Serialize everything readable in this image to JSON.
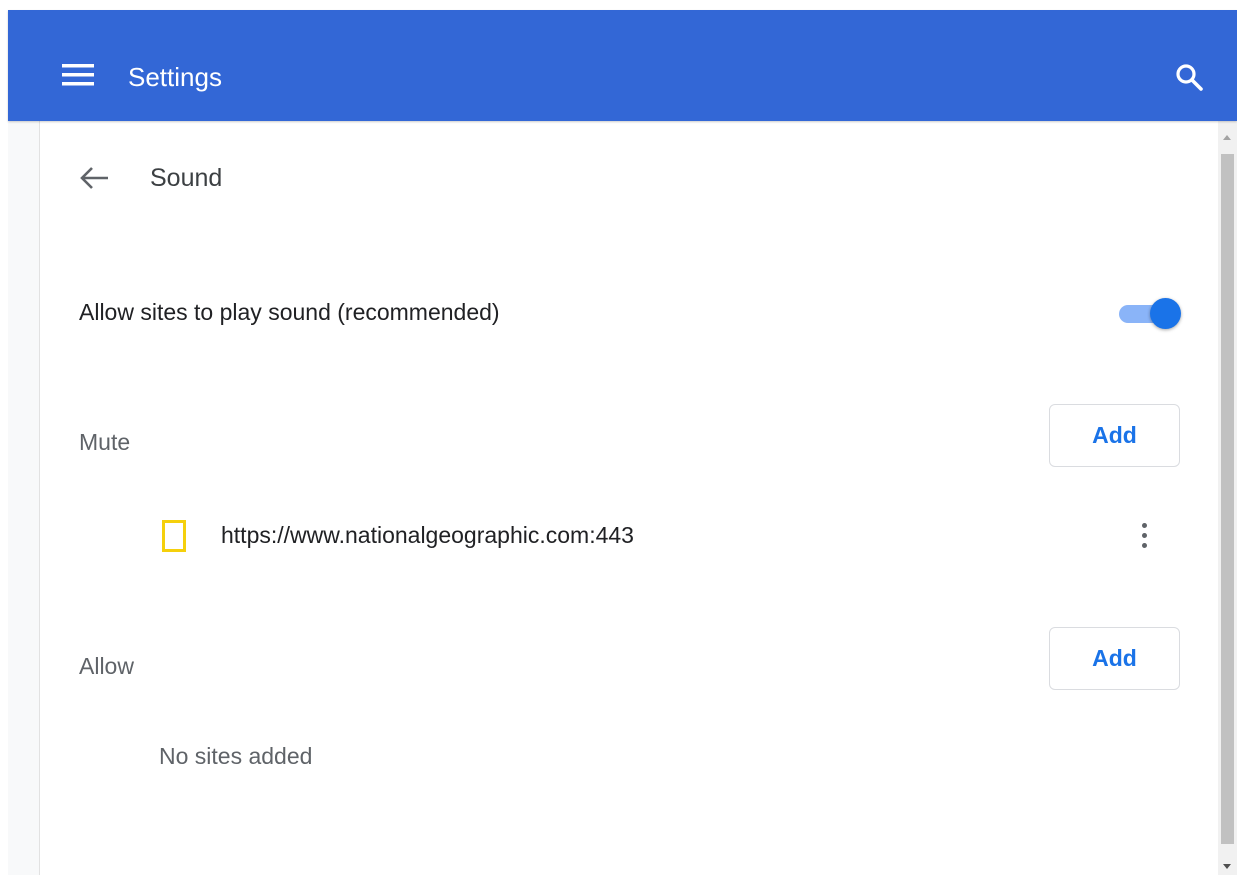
{
  "header": {
    "title": "Settings",
    "background_color": "#3367d6",
    "menu_icon": "hamburger-menu-icon",
    "search_icon": "search-icon"
  },
  "subpage": {
    "title": "Sound",
    "back_icon": "arrow-back-icon"
  },
  "main_setting": {
    "label": "Allow sites to play sound (recommended)",
    "enabled": true,
    "accent_color": "#1a73e8"
  },
  "mute_section": {
    "label": "Mute",
    "add_label": "Add",
    "sites": [
      {
        "url": "https://www.nationalgeographic.com:443",
        "favicon": "national-geographic-favicon-icon",
        "favicon_color": "#f5d00c",
        "menu_icon": "more-vertical-icon"
      }
    ]
  },
  "allow_section": {
    "label": "Allow",
    "add_label": "Add",
    "empty_text": "No sites added"
  }
}
